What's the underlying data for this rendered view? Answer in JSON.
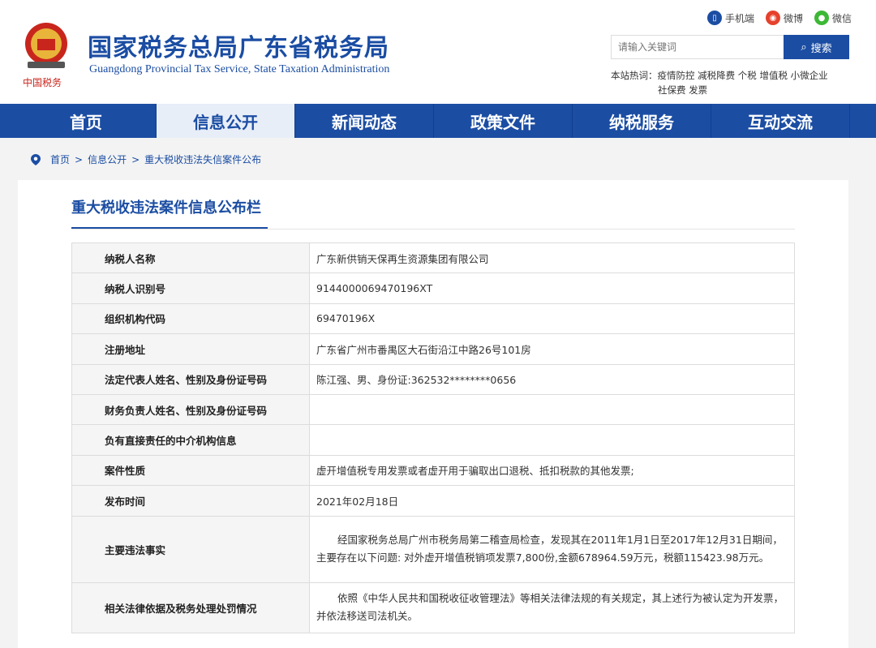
{
  "header": {
    "title": "国家税务总局广东省税务局",
    "subtitle": "Guangdong Provincial Tax Service, State Taxation Administration",
    "logo_text": "中国税务",
    "social": [
      {
        "label": "手机端",
        "color": "#1b4da3",
        "icon": "mobile-icon"
      },
      {
        "label": "微博",
        "color": "#e6412d",
        "icon": "weibo-icon"
      },
      {
        "label": "微信",
        "color": "#3db835",
        "icon": "wechat-icon"
      }
    ],
    "search": {
      "placeholder": "请输入关键词",
      "button": "搜索"
    },
    "hot_label": "本站热词：",
    "hot_words_line1": "疫情防控 减税降费 个税 增值税 小微企业",
    "hot_words_line2": "社保费 发票"
  },
  "nav": [
    "首页",
    "信息公开",
    "新闻动态",
    "政策文件",
    "纳税服务",
    "互动交流"
  ],
  "breadcrumb": {
    "home": "首页",
    "sep": ">",
    "level1": "信息公开",
    "level2": "重大税收违法失信案件公布"
  },
  "panel": {
    "title": "重大税收违法案件信息公布栏",
    "rows": [
      {
        "key": "纳税人名称",
        "value": "广东新供销天保再生资源集团有限公司"
      },
      {
        "key": "纳税人识别号",
        "value": "9144000069470196XT"
      },
      {
        "key": "组织机构代码",
        "value": "69470196X"
      },
      {
        "key": "注册地址",
        "value": "广东省广州市番禺区大石街沿江中路26号101房"
      },
      {
        "key": "法定代表人姓名、性别及身份证号码",
        "value": "陈江强、男、身份证:362532********0656"
      },
      {
        "key": "财务负责人姓名、性别及身份证号码",
        "value": ""
      },
      {
        "key": "负有直接责任的中介机构信息",
        "value": ""
      },
      {
        "key": "案件性质",
        "value": "虚开增值税专用发票或者虚开用于骗取出口退税、抵扣税款的其他发票;"
      },
      {
        "key": "发布时间",
        "value": "2021年02月18日"
      },
      {
        "key": "主要违法事实",
        "value": "经国家税务总局广州市税务局第二稽查局检查，发现其在2011年1月1日至2017年12月31日期间，主要存在以下问题: 对外虚开增值税销项发票7,800份,金额678964.59万元，税额115423.98万元。"
      },
      {
        "key": "相关法律依据及税务处理处罚情况",
        "value": "依照《中华人民共和国税收征收管理法》等相关法律法规的有关规定，其上述行为被认定为开发票，并依法移送司法机关。"
      }
    ]
  }
}
